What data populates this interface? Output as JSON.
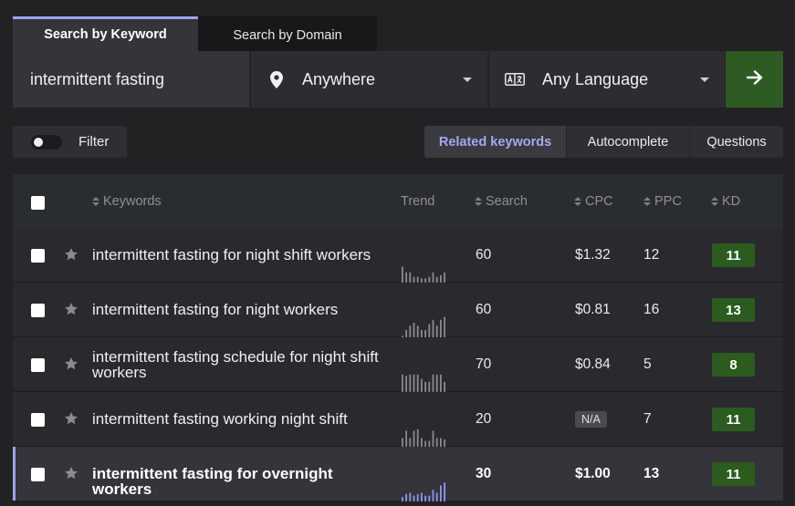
{
  "tabs": [
    {
      "label": "Search by Keyword",
      "active": true
    },
    {
      "label": "Search by Domain",
      "active": false
    }
  ],
  "search": {
    "keyword": "intermittent fasting",
    "location": "Anywhere",
    "language": "Any Language",
    "location_icon": "map-pin-icon",
    "language_icon": "translate-icon",
    "submit_icon": "arrow-right-icon"
  },
  "filter": {
    "label": "Filter",
    "enabled": false
  },
  "result_tabs": [
    {
      "label": "Related keywords",
      "active": true
    },
    {
      "label": "Autocomplete",
      "active": false
    },
    {
      "label": "Questions",
      "active": false
    }
  ],
  "table": {
    "headers": {
      "keywords": "Keywords",
      "trend": "Trend",
      "search": "Search",
      "cpc": "CPC",
      "ppc": "PPC",
      "kd": "KD"
    },
    "rows": [
      {
        "keyword": "intermittent fasting for night shift workers",
        "search": "60",
        "cpc": "$1.32",
        "cpc_na": false,
        "ppc": "12",
        "kd": "11",
        "trend": [
          0.55,
          0.35,
          0.35,
          0.2,
          0.2,
          0.15,
          0.15,
          0.2,
          0.35,
          0.2,
          0.25,
          0.35
        ],
        "highlighted": false
      },
      {
        "keyword": "intermittent fasting for night workers",
        "search": "60",
        "cpc": "$0.81",
        "cpc_na": false,
        "ppc": "16",
        "kd": "13",
        "trend": [
          0.05,
          0.25,
          0.4,
          0.5,
          0.4,
          0.25,
          0.25,
          0.45,
          0.6,
          0.4,
          0.6,
          0.7
        ],
        "highlighted": false
      },
      {
        "keyword": "intermittent fasting schedule for night shift workers",
        "search": "70",
        "cpc": "$0.84",
        "cpc_na": false,
        "ppc": "5",
        "kd": "8",
        "trend": [
          0.6,
          0.55,
          0.6,
          0.6,
          0.6,
          0.45,
          0.35,
          0.35,
          0.6,
          0.6,
          0.6,
          0.35
        ],
        "highlighted": false
      },
      {
        "keyword": "intermittent fasting working night shift",
        "search": "20",
        "cpc": "N/A",
        "cpc_na": true,
        "ppc": "7",
        "kd": "11",
        "trend": [
          0.3,
          0.55,
          0.3,
          0.55,
          0.6,
          0.3,
          0.2,
          0.2,
          0.55,
          0.3,
          0.3,
          0.25
        ],
        "highlighted": false
      },
      {
        "keyword": "intermittent fasting for overnight workers",
        "search": "30",
        "cpc": "$1.00",
        "cpc_na": false,
        "ppc": "13",
        "kd": "11",
        "trend": [
          0.15,
          0.25,
          0.3,
          0.2,
          0.25,
          0.3,
          0.2,
          0.2,
          0.4,
          0.3,
          0.55,
          0.65
        ],
        "highlighted": true
      }
    ]
  },
  "colors": {
    "accent": "#9ea2ee",
    "submit_green": "#2e5a23",
    "kd_green": "#2c5b20",
    "trend_gray": "#8a8a8e",
    "trend_highlight": "#8f96ee"
  }
}
